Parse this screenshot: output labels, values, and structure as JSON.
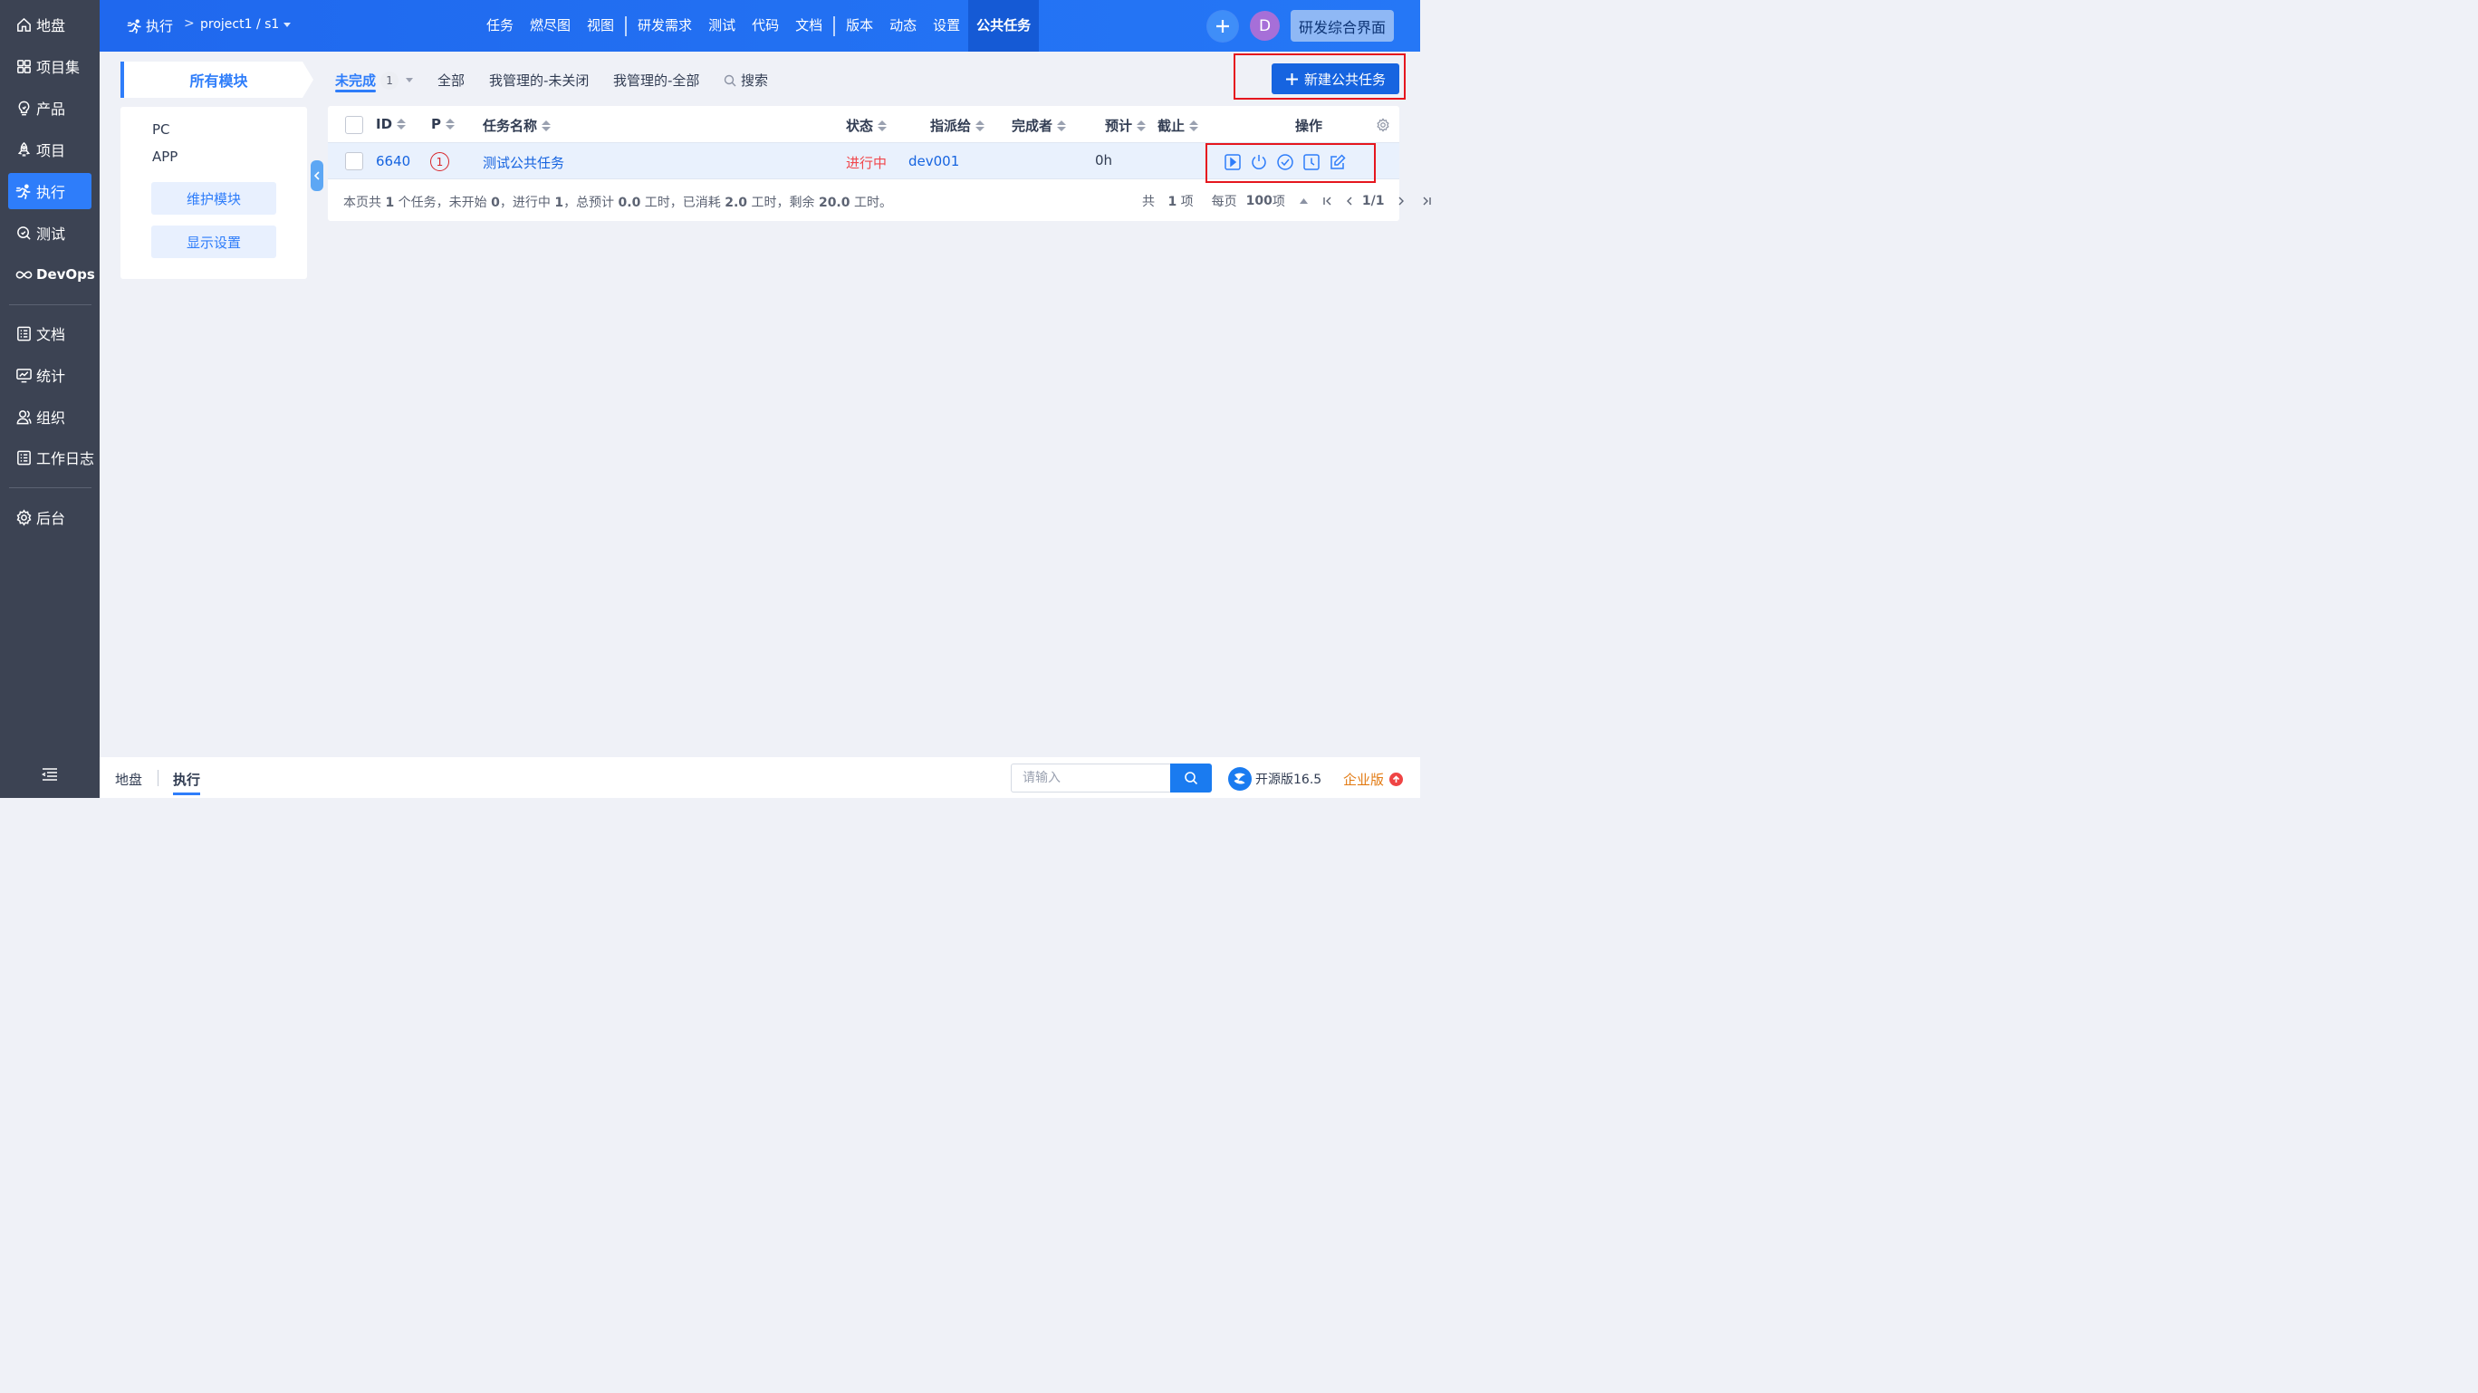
{
  "sidebar": {
    "items": [
      {
        "label": "地盘",
        "icon": "home-icon"
      },
      {
        "label": "项目集",
        "icon": "grid-icon"
      },
      {
        "label": "产品",
        "icon": "lightbulb-icon"
      },
      {
        "label": "项目",
        "icon": "rocket-icon"
      },
      {
        "label": "执行",
        "icon": "run-icon",
        "active": true
      },
      {
        "label": "测试",
        "icon": "search-bug-icon"
      },
      {
        "label": "DevOps",
        "icon": "infinity-icon"
      },
      {
        "label": "文档",
        "icon": "list-doc-icon"
      },
      {
        "label": "统计",
        "icon": "chart-monitor-icon"
      },
      {
        "label": "组织",
        "icon": "people-icon"
      },
      {
        "label": "工作日志",
        "icon": "list-doc-icon"
      },
      {
        "label": "后台",
        "icon": "gear-icon"
      }
    ]
  },
  "header": {
    "breadcrumb": {
      "module": "执行",
      "separator": ">",
      "project": "project1 / s1"
    },
    "nav": [
      "任务",
      "燃尽图",
      "视图",
      "研发需求",
      "测试",
      "代码",
      "文档",
      "版本",
      "动态",
      "设置",
      "公共任务"
    ],
    "active_nav": "公共任务",
    "avatar_letter": "D",
    "switch_label": "研发综合界面"
  },
  "modules": {
    "tab_label": "所有模块",
    "items": [
      "PC",
      "APP"
    ],
    "maintain_label": "维护模块",
    "display_label": "显示设置"
  },
  "filters": {
    "unfinished": "未完成",
    "unfinished_count": "1",
    "all": "全部",
    "managed_open": "我管理的-未关闭",
    "managed_all": "我管理的-全部",
    "search": "搜索"
  },
  "new_task_label": "新建公共任务",
  "table": {
    "columns": {
      "id": "ID",
      "pri": "P",
      "name": "任务名称",
      "status": "状态",
      "assigned": "指派给",
      "finisher": "完成者",
      "estimate": "预计",
      "deadline": "截止",
      "actions": "操作"
    },
    "rows": [
      {
        "id": "6640",
        "pri": "1",
        "name": "测试公共任务",
        "status": "进行中",
        "assigned": "dev001",
        "finisher": "",
        "estimate": "0h",
        "deadline": ""
      }
    ],
    "summary": {
      "prefix": "本页共 ",
      "total": "1",
      "mid1": " 个任务，未开始 ",
      "not_started": "0",
      "mid2": "，进行中 ",
      "doing": "1",
      "mid3": "，总预计 ",
      "estimate": "0.0",
      "mid4": " 工时，已消耗 ",
      "consumed": "2.0",
      "mid5": " 工时，剩余 ",
      "left": "20.0",
      "suffix": " 工时。"
    },
    "pager": {
      "total_prefix": "共 ",
      "total": "1",
      "total_suffix": " 项",
      "per_prefix": "每页 ",
      "per_page": "100",
      "per_suffix": " 项",
      "page": "1/1"
    }
  },
  "footer": {
    "crumbs": [
      "地盘",
      "执行"
    ],
    "search_placeholder": "请输入",
    "version": "开源版16.5",
    "enterprise": "企业版"
  },
  "colors": {
    "primary": "#2e7dfa",
    "sidebar": "#3c4353",
    "danger": "#e5161e",
    "status_doing": "#f0474c",
    "enterprise": "#e27a12"
  }
}
